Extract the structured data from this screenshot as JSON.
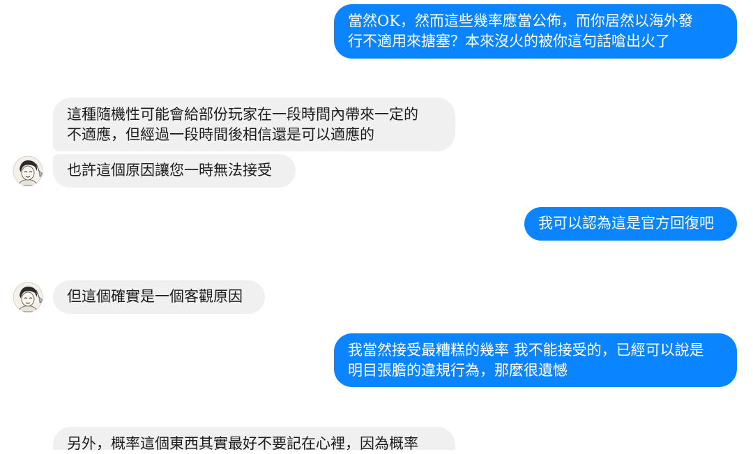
{
  "messages": [
    {
      "sender": "me",
      "lines": [
        "當然OK，然而這些幾率應當公佈，而你居然以海外發",
        "行不適用來搪塞？本來沒火的被你這句話嗆出火了"
      ]
    },
    {
      "sender": "other",
      "lines": [
        "這種隨機性可能會給部份玩家在一段時間內帶來一定的",
        "不適應，但經過一段時間後相信還是可以適應的"
      ]
    },
    {
      "sender": "other",
      "lines": [
        "也許這個原因讓您一時無法接受"
      ]
    },
    {
      "sender": "me",
      "lines": [
        "我可以認為這是官方回復吧"
      ]
    },
    {
      "sender": "other",
      "lines": [
        "但這個確實是一個客觀原因"
      ]
    },
    {
      "sender": "me",
      "lines": [
        "我當然接受最糟糕的幾率 我不能接受的，已經可以說是",
        "明目張膽的違規行為，那麼很遺憾"
      ]
    },
    {
      "sender": "other",
      "lines": [
        "另外，概率這個東西其實最好不要記在心裡，因為概率"
      ]
    }
  ],
  "colors": {
    "outgoing_bubble": "#0a84ff",
    "incoming_bubble": "#f0f0f0"
  },
  "icons": {
    "avatar": "sketch-character-avatar"
  }
}
